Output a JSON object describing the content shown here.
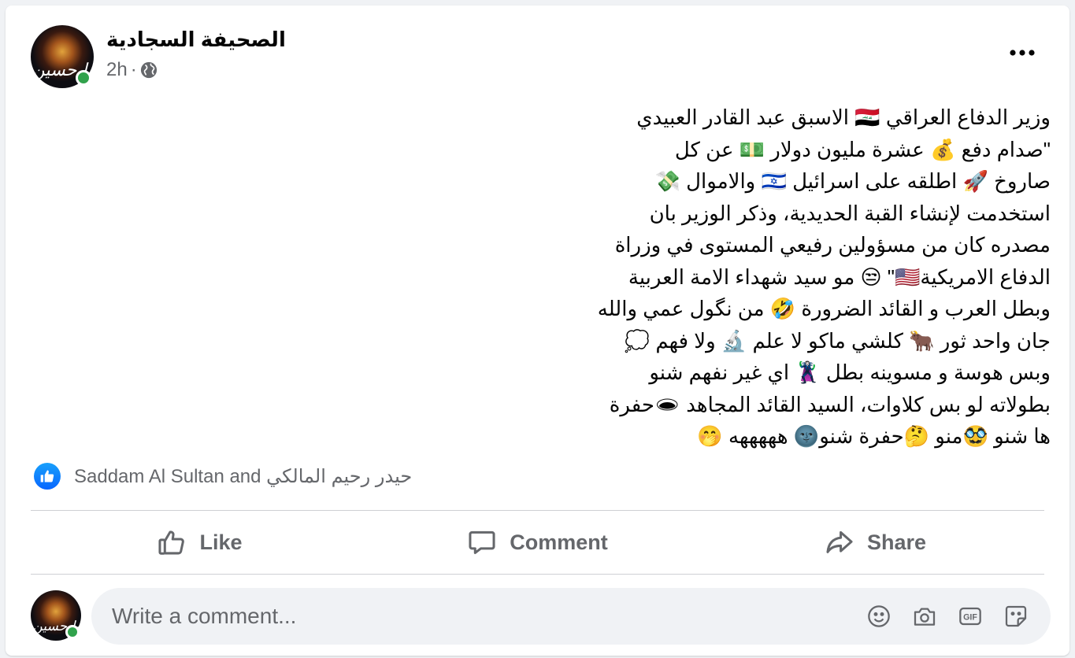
{
  "post": {
    "page_name": "الصحيفة السجادية",
    "timestamp": "2h",
    "dot": "·",
    "avatar_text": "يا حسين",
    "more_label": "•••",
    "text_lines": [
      "وزير الدفاع العراقي 🇮🇶 الاسبق عبد القادر العبيدي",
      "\"صدام دفع 💰 عشرة مليون دولار 💵 عن كل",
      "صاروخ 🚀 اطلقه على اسرائيل 🇮🇱 والاموال 💸",
      "استخدمت لإنشاء القبة الحديدية، وذكر الوزير بان",
      "مصدره كان من مسؤولين رفيعي المستوى في وزراة",
      "الدفاع الامريكية🇺🇸\" 😒 مو سيد شهداء الامة العربية",
      "وبطل العرب و القائد الضرورة 🤣 من نگول عمي والله",
      "جان واحد ثور 🐂 كلشي ماكو لا علم 🔬 ولا فهم 💭",
      "وبس هوسة و مسوينه بطل 🦹 اي غير نفهم شنو",
      "بطولاته لو بس كلاوات، السيد القائد المجاهد 🕳حفرة",
      "ها شنو 🥸منو 🤔حفرة شنو🌚 هههههه 🤭"
    ]
  },
  "reactions": {
    "text": "Saddam Al Sultan and حيدر رحيم المالكي"
  },
  "actions": {
    "like": "Like",
    "comment": "Comment",
    "share": "Share"
  },
  "composer": {
    "placeholder": "Write a comment...",
    "avatar_text": "يا حسين",
    "icons": [
      "emoji-icon",
      "camera-icon",
      "gif-icon",
      "sticker-icon"
    ]
  },
  "colors": {
    "secondary_text": "#65676b",
    "like_blue": "#0866ff",
    "online_green": "#31a24c",
    "background": "#f0f2f5"
  }
}
